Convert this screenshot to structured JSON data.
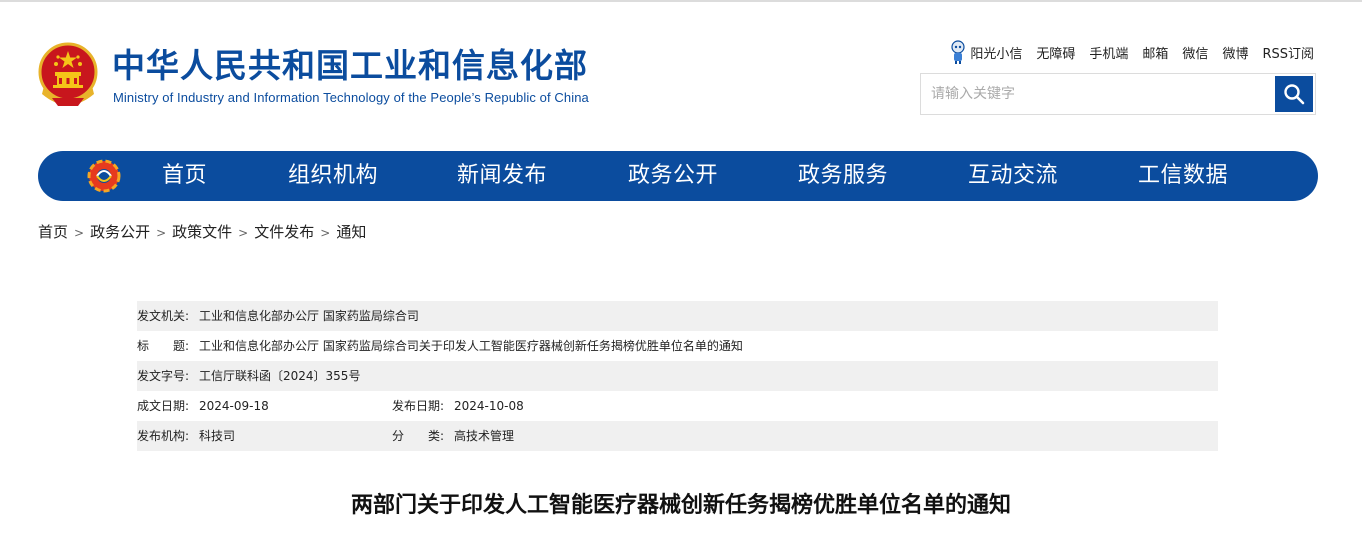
{
  "header": {
    "title": "中华人民共和国工业和信息化部",
    "subtitle": "Ministry of Industry and Information Technology of the People’s Republic of China"
  },
  "toplinks": [
    "阳光小信",
    "无障碍",
    "手机端",
    "邮箱",
    "微信",
    "微博",
    "RSS订阅"
  ],
  "search": {
    "placeholder": "请输入关键字"
  },
  "nav": [
    "首页",
    "组织机构",
    "新闻发布",
    "政务公开",
    "政务服务",
    "互动交流",
    "工信数据"
  ],
  "breadcrumb": [
    "首页",
    "政务公开",
    "政策文件",
    "文件发布",
    "通知"
  ],
  "info": {
    "issuer_label": "发文机关:",
    "issuer": "工业和信息化部办公厅 国家药监局综合司",
    "title_label": "标　　题:",
    "title": "工业和信息化部办公厅 国家药监局综合司关于印发人工智能医疗器械创新任务揭榜优胜单位名单的通知",
    "docno_label": "发文字号:",
    "docno": "工信厅联科函〔2024〕355号",
    "written_label": "成文日期:",
    "written": "2024-09-18",
    "published_label": "发布日期:",
    "published": "2024-10-08",
    "org_label": "发布机构:",
    "org": "科技司",
    "category_label": "分　　类:",
    "category": "高技术管理"
  },
  "document_title": "两部门关于印发人工智能医疗器械创新任务揭榜优胜单位名单的通知",
  "colors": {
    "brand_blue": "#0b4c9e",
    "row_shade": "#f0f0f0"
  }
}
